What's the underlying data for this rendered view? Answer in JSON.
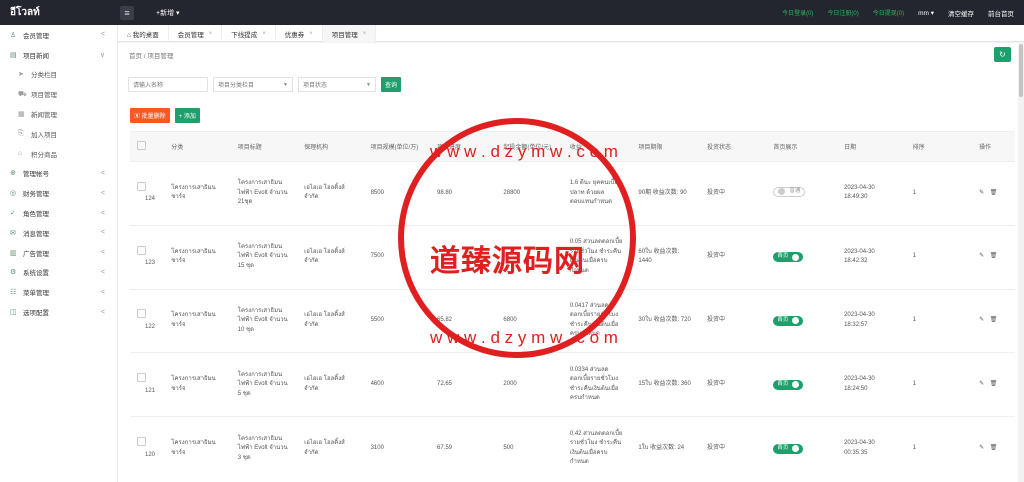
{
  "topbar": {
    "brand": "อีโวลท์",
    "new_label": "+新增 ▾",
    "right": [
      "今日登录(0)",
      "今日注册(0)",
      "今日提现(0)",
      "mm ▾",
      "清空缓存",
      "前台首页"
    ]
  },
  "sidebar": [
    {
      "icon": "user-icon",
      "label": "会员管理",
      "chev": "<",
      "sub": false
    },
    {
      "icon": "news-icon",
      "label": "项目新闻",
      "chev": "∨",
      "sub": false
    },
    {
      "icon": "arrow-icon",
      "label": "分类栏目",
      "chev": "",
      "sub": true
    },
    {
      "icon": "cart-icon",
      "label": "项目管理",
      "chev": "",
      "sub": true
    },
    {
      "icon": "doc-icon",
      "label": "新闻管理",
      "chev": "",
      "sub": true
    },
    {
      "icon": "join-icon",
      "label": "加入项目",
      "chev": "",
      "sub": true
    },
    {
      "icon": "shop-icon",
      "label": "积分商品",
      "chev": "",
      "sub": true
    },
    {
      "icon": "money-icon",
      "label": "管理帐号",
      "chev": "<",
      "sub": false
    },
    {
      "icon": "finance-icon",
      "label": "财务管理",
      "chev": "<",
      "sub": false
    },
    {
      "icon": "role-icon",
      "label": "角色管理",
      "chev": "<",
      "sub": false
    },
    {
      "icon": "message-icon",
      "label": "消息管理",
      "chev": "<",
      "sub": false
    },
    {
      "icon": "ad-icon",
      "label": "广告管理",
      "chev": "<",
      "sub": false
    },
    {
      "icon": "settings-icon",
      "label": "系统设置",
      "chev": "<",
      "sub": false
    },
    {
      "icon": "menu-icon",
      "label": "菜单管理",
      "chev": "<",
      "sub": false
    },
    {
      "icon": "config-icon",
      "label": "选项配置",
      "chev": "<",
      "sub": false
    }
  ],
  "tabs": [
    {
      "label": "⌂ 我的桌面",
      "close": ""
    },
    {
      "label": "会员管理",
      "close": "×"
    },
    {
      "label": "下线提成",
      "close": "×"
    },
    {
      "label": "优惠券",
      "close": "×"
    },
    {
      "label": "项目管理",
      "close": "×"
    }
  ],
  "breadcrumb": "首页 / 项目管理",
  "refresh_glyph": "↻",
  "filters": {
    "name_placeholder": "请输入名称",
    "category": "项目分类栏目",
    "status": "项目状态",
    "query": "查询"
  },
  "buttons": {
    "delete": "▣ 批量删除",
    "add": "+ 添加"
  },
  "columns": [
    "",
    "分类",
    "项目标题",
    "保理机构",
    "项目规模(单位/万)",
    "项目进度",
    "起投金额(单位/元)",
    "收益",
    "项目期限",
    "投资状态",
    "首页展示",
    "日期",
    "排序",
    "操作"
  ],
  "rows": [
    {
      "id": "124",
      "cat": "โครงการเสาธิมนชาร์จ",
      "title": "โครงการเสาธิมนไฟฟ้า Evolt จำนวน 21ชุด",
      "org": "เอไอเอ โฮลดิ้งส์ จำกัด",
      "scale": "8500",
      "progress": "98.80",
      "min": "28800",
      "yield": "1.6 ดีนะ ยุคคนเบี้ยปลาท ด้วยผลตอบแทนกำหนด",
      "term": "90期 收益次数: 90",
      "status": "投资中",
      "show": "普通",
      "show_on": false,
      "date": "2023-04-30 18:49:30",
      "sort": "1"
    },
    {
      "id": "123",
      "cat": "โครงการเสาธิมนชาร์จ",
      "title": "โครงการเสาธิมนไฟฟ้า Evolt จำนวน 15 ชุด",
      "org": "เอไอเอ โฮลดิ้งส์ จำกัด",
      "scale": "7500",
      "progress": "",
      "min": "",
      "yield": "0.05 ส่วนลดดอกเบี้ยรายชั่วโมง ชำระคืนเงินต้นเมื่อครบกำหนด",
      "term": "60ใบ 收益次数: 1440",
      "status": "投资中",
      "show": "首页",
      "show_on": true,
      "date": "2023-04-30 18:42:32",
      "sort": "1"
    },
    {
      "id": "122",
      "cat": "โครงการเสาธิมนชาร์จ",
      "title": "โครงการเสาธิมนไฟฟ้า Evolt จำนวน 10 ชุด",
      "org": "เอไอเอ โฮลดิ้งส์ จำกัด",
      "scale": "5500",
      "progress": "65.82",
      "min": "6800",
      "yield": "0.0417 ส่วนลดดอกเบี้ยรายชั่วโมง ชำระคืนเงินต้นเมื่อครบกำหนด",
      "term": "30ใบ 收益次数: 720",
      "status": "投资中",
      "show": "首页",
      "show_on": true,
      "date": "2023-04-30 18:32:57",
      "sort": "1"
    },
    {
      "id": "121",
      "cat": "โครงการเสาธิมนชาร์จ",
      "title": "โครงการเสาธิมนไฟฟ้า Evolt จำนวน 5 ชุด",
      "org": "เอไอเอ โฮลดิ้งส์ จำกัด",
      "scale": "4600",
      "progress": "72.65",
      "min": "2000",
      "yield": "0.0334 ส่วนลดดอกเบี้ยรายชั่วโมง ชำระคืนเงินต้นเมื่อครบกำหนด",
      "term": "15ใบ 收益次数: 360",
      "status": "投资中",
      "show": "首页",
      "show_on": true,
      "date": "2023-04-30 18:24:50",
      "sort": "1"
    },
    {
      "id": "120",
      "cat": "โครงการเสาธิมนชาร์จ",
      "title": "โครงการเสาธิมนไฟฟ้า Evolt จำนวน 3 ชุด",
      "org": "เอไอเอ โฮลดิ้งส์ จำกัด",
      "scale": "3100",
      "progress": "67.59",
      "min": "500",
      "yield": "0.42 ส่วนลดดอกเบี้ยรายชั่วโมง ชำระคืนเงินต้นเมื่อครบกำหนด",
      "term": "1ใบ 收益次数: 24",
      "status": "投资中",
      "show": "首页",
      "show_on": true,
      "date": "2023-04-30 00:35:35",
      "sort": "1"
    }
  ],
  "ops_glyphs": "✎ 🗑",
  "watermark": {
    "main": "道臻源码网",
    "url_top": "w w w . d z y m w . c o m",
    "url_bottom": "w w w . d z y m w . c o m"
  }
}
